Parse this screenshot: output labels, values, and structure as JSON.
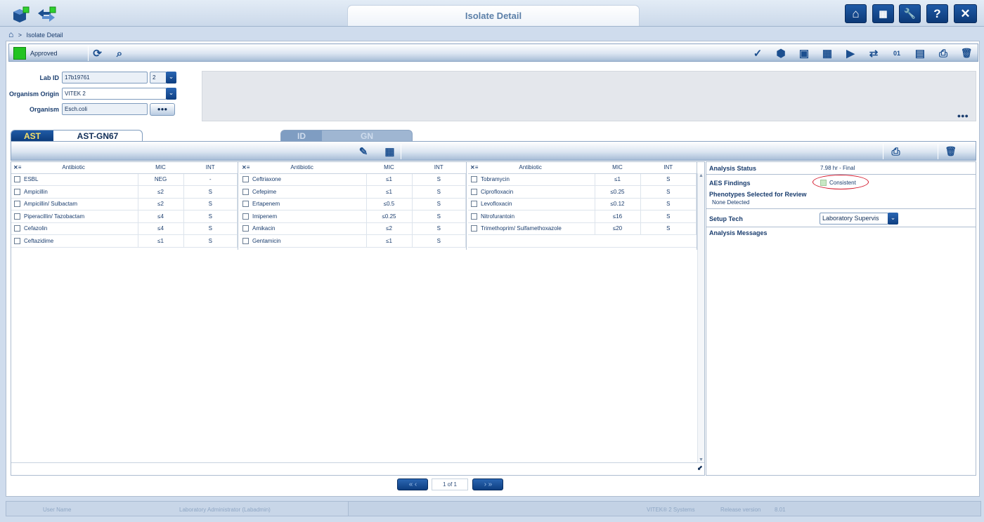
{
  "window": {
    "title": "Isolate Detail"
  },
  "breadcrumb": {
    "separator": ">",
    "current": "Isolate Detail"
  },
  "top_buttons": [
    "home-icon",
    "instrument-icon",
    "wrench-icon",
    "help-icon",
    "close-icon"
  ],
  "top_glyphs": {
    "home": "⌂",
    "instrument": "▦",
    "wrench": "🔧",
    "help": "?",
    "close": "✕"
  },
  "status": {
    "label": "Approved",
    "color": "#22c322"
  },
  "toolbar_icons": [
    "check-icon",
    "cube-icon",
    "card-check-icon",
    "card-grid-icon",
    "play-icon",
    "transfer-icon",
    "binary-icon",
    "card-export-icon",
    "print-icon",
    "trash-icon"
  ],
  "toolbar_glyphs": {
    "check": "✓",
    "cube": "⬢",
    "card_check": "▣",
    "card_grid": "▦",
    "play": "▶",
    "transfer": "⇄",
    "binary": "01",
    "card_export": "▤",
    "print": "⎙",
    "trash": "🗑"
  },
  "form": {
    "lab_id_label": "Lab ID",
    "lab_id": "17b19761",
    "lab_id_seq": "2",
    "organism_origin_label": "Organism Origin",
    "organism_origin": "VITEK 2",
    "organism_label": "Organism",
    "organism": "Esch.coli",
    "more_glyph": "●●●"
  },
  "tabs": {
    "ast": "AST",
    "ast_card": "AST-GN67",
    "id": "ID",
    "gn": "GN"
  },
  "ast_table": {
    "headers": {
      "antibiotic": "Antibiotic",
      "mic": "MIC",
      "int": "INT"
    },
    "col1": [
      {
        "name": "ESBL",
        "mic": "NEG",
        "int": "-"
      },
      {
        "name": "Ampicillin",
        "mic": "≤2",
        "int": "S"
      },
      {
        "name": "Ampicillin/ Sulbactam",
        "mic": "≤2",
        "int": "S"
      },
      {
        "name": "Piperacillin/ Tazobactam",
        "mic": "≤4",
        "int": "S"
      },
      {
        "name": "Cefazolin",
        "mic": "≤4",
        "int": "S"
      },
      {
        "name": "Ceftazidime",
        "mic": "≤1",
        "int": "S"
      }
    ],
    "col2": [
      {
        "name": "Ceftriaxone",
        "mic": "≤1",
        "int": "S"
      },
      {
        "name": "Cefepime",
        "mic": "≤1",
        "int": "S"
      },
      {
        "name": "Ertapenem",
        "mic": "≤0.5",
        "int": "S"
      },
      {
        "name": "Imipenem",
        "mic": "≤0.25",
        "int": "S"
      },
      {
        "name": "Amikacin",
        "mic": "≤2",
        "int": "S"
      },
      {
        "name": "Gentamicin",
        "mic": "≤1",
        "int": "S"
      }
    ],
    "col3": [
      {
        "name": "Tobramycin",
        "mic": "≤1",
        "int": "S"
      },
      {
        "name": "Ciprofloxacin",
        "mic": "≤0.25",
        "int": "S"
      },
      {
        "name": "Levofloxacin",
        "mic": "≤0.12",
        "int": "S"
      },
      {
        "name": "Nitrofurantoin",
        "mic": "≤16",
        "int": "S"
      },
      {
        "name": "Trimethoprim/ Sulfamethoxazole",
        "mic": "≤20",
        "int": "S"
      }
    ]
  },
  "analysis": {
    "status_label": "Analysis Status",
    "status_value": "7.98 hr - Final",
    "aes_label": "AES Findings",
    "aes_value": "Consistent",
    "phenotypes_label": "Phenotypes Selected for Review",
    "phenotypes_value": "None Detected",
    "setup_tech_label": "Setup Tech",
    "setup_tech_value": "Laboratory Supervis",
    "messages_label": "Analysis Messages"
  },
  "pager": {
    "text": "1 of 1",
    "first": "«",
    "prev": "‹",
    "next": "›",
    "last": "»"
  },
  "footer": {
    "user_label": "User Name",
    "user_value": "Laboratory Administrator (Labadmin)",
    "system": "VITEK® 2 Systems",
    "release_label": "Release version",
    "release_value": "8.01"
  }
}
